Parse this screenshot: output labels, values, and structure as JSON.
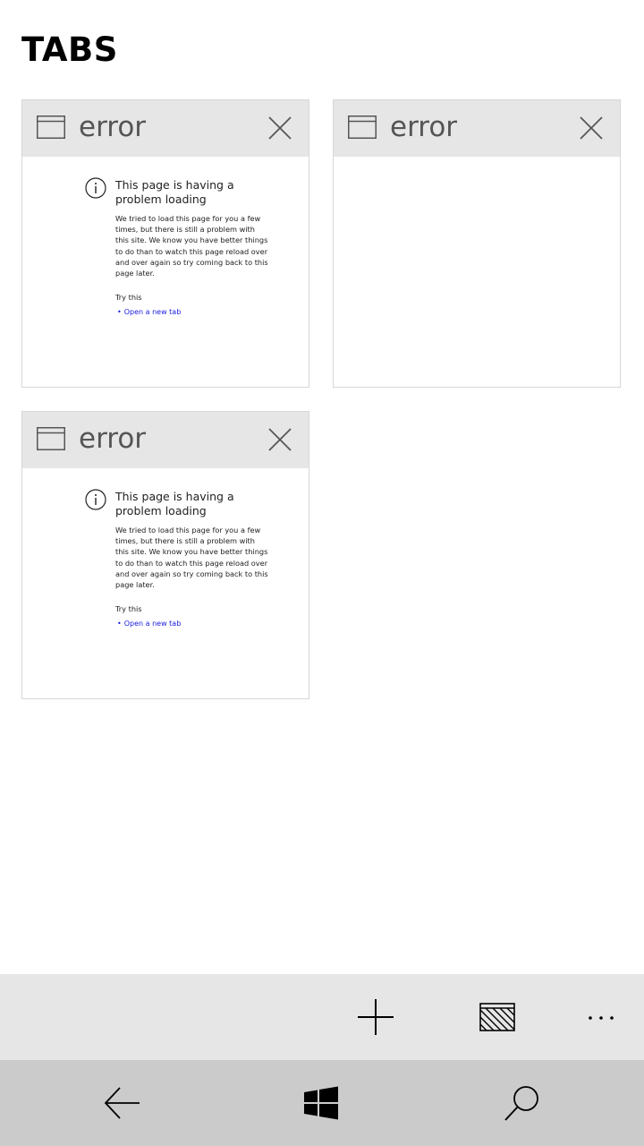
{
  "header": {
    "title": "TABS"
  },
  "tabs": [
    {
      "title": "error",
      "preview": {
        "heading": "This page is having a problem loading",
        "body": "We tried to load this page for you a few times, but there is still a problem with this site. We know you have better things to do than to watch this page reload over and over again so try coming back to this page later.",
        "try_label": "Try this",
        "link_label": "Open a new tab"
      }
    },
    {
      "title": "error",
      "preview": null
    },
    {
      "title": "error",
      "preview": {
        "heading": "This page is having a problem loading",
        "body": "We tried to load this page for you a few times, but there is still a problem with this site. We know you have better things to do than to watch this page reload over and over again so try coming back to this page later.",
        "try_label": "Try this",
        "link_label": "Open a new tab"
      }
    }
  ],
  "app_bar": {
    "buttons": [
      {
        "icon": "plus-icon"
      },
      {
        "icon": "inprivate-icon"
      },
      {
        "icon": "more-icon"
      }
    ],
    "more_glyph": "..."
  },
  "nav_bar": {
    "buttons": [
      {
        "icon": "back-arrow-icon"
      },
      {
        "icon": "windows-logo-icon"
      },
      {
        "icon": "search-icon"
      }
    ]
  },
  "colors": {
    "tab_header_bg": "#e6e6e6",
    "app_bar_bg": "#e6e6e6",
    "nav_bar_bg": "#cbcbcb",
    "link": "#1a1ae0"
  }
}
